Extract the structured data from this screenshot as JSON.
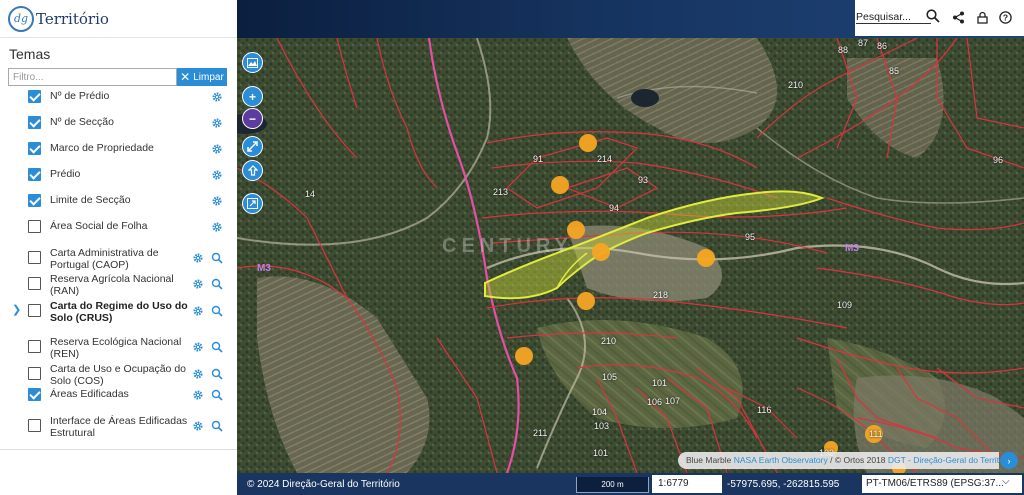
{
  "logo": {
    "mark": "dg",
    "text": "Território"
  },
  "panel": {
    "title": "Temas",
    "filter_placeholder": "Filtro...",
    "clear_label": "Limpar",
    "layers": [
      {
        "label": "Nº de Prédio",
        "checked": true,
        "search": false,
        "expand": false,
        "bold": false
      },
      {
        "label": "Nº de Secção",
        "checked": true,
        "search": false,
        "expand": false,
        "bold": false
      },
      {
        "label": "Marco de Propriedade",
        "checked": true,
        "search": false,
        "expand": false,
        "bold": false
      },
      {
        "label": "Prédio",
        "checked": true,
        "search": false,
        "expand": false,
        "bold": false
      },
      {
        "label": "Limite de Secção",
        "checked": true,
        "search": false,
        "expand": false,
        "bold": false
      },
      {
        "label": "Área Social de Folha",
        "checked": false,
        "search": false,
        "expand": false,
        "bold": false
      },
      {
        "label": "Carta Administrativa de Portugal (CAOP)",
        "checked": false,
        "search": true,
        "expand": false,
        "bold": false
      },
      {
        "label": "Reserva Agrícola Nacional (RAN)",
        "checked": false,
        "search": true,
        "expand": false,
        "bold": false
      },
      {
        "label": "Carta do Regime do Uso do Solo (CRUS)",
        "checked": false,
        "search": true,
        "expand": true,
        "bold": true
      },
      {
        "label": "Reserva Ecológica Nacional (REN)",
        "checked": false,
        "search": true,
        "expand": false,
        "bold": false
      },
      {
        "label": "Carta de Uso e Ocupação do Solo (COS)",
        "checked": false,
        "search": true,
        "expand": false,
        "bold": false
      },
      {
        "label": "Áreas Edificadas",
        "checked": true,
        "search": true,
        "expand": false,
        "bold": false
      },
      {
        "label": "Interface de Áreas Edificadas Estrutural",
        "checked": false,
        "search": true,
        "expand": false,
        "bold": false
      }
    ]
  },
  "topbar": {
    "search_label": "Pesquisar..."
  },
  "map": {
    "watermark": "CENTURY",
    "parcel_labels": [
      "88",
      "87",
      "86",
      "85",
      "91",
      "214",
      "93",
      "213",
      "14",
      "94",
      "95",
      "109",
      "210",
      "101",
      "105",
      "106",
      "107",
      "104",
      "103",
      "211",
      "101",
      "102",
      "116",
      "111",
      "210",
      "96",
      "218"
    ],
    "attribution": {
      "prefix": "Blue Marble",
      "link1": "NASA Earth Observatory",
      "mid": " / © Ortos 2018 ",
      "link2": "DGT - Direção-Geral do Território"
    }
  },
  "bottombar": {
    "copyright": "© 2024 Direção-Geral do Território",
    "scale": "200 m",
    "ratio": "1:6779",
    "coordinates": "-57975.695, -262815.595",
    "crs": "PT-TM06/ETRS89 (EPSG:37..."
  },
  "colors": {
    "accent": "#2b8dd6",
    "parcel_line": "#d8343f",
    "highlight_fill": "#c8d43a",
    "marker": "#f5a623",
    "section_line": "#e64fa3"
  }
}
